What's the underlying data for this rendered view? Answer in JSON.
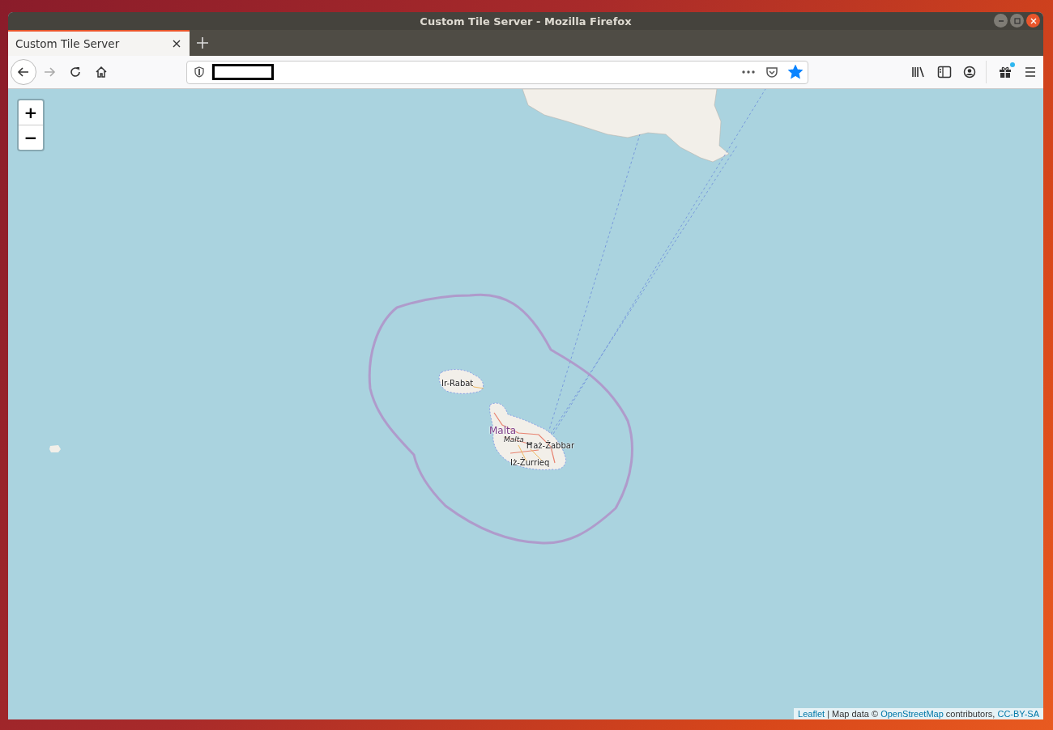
{
  "window": {
    "title": "Custom Tile Server - Mozilla Firefox"
  },
  "tabs": [
    {
      "label": "Custom Tile Server",
      "selected": true
    }
  ],
  "toolbar": {
    "forward_disabled": true,
    "bookmarked": true,
    "gift_notification": true
  },
  "map": {
    "zoom_controls": [
      "+",
      "−"
    ],
    "labels": [
      {
        "text": "Ir-Rabat",
        "kind": "town"
      },
      {
        "text": "Malta",
        "kind": "country"
      },
      {
        "text": "Malta",
        "kind": "island"
      },
      {
        "text": "Ħaż-Żabbar",
        "kind": "town"
      },
      {
        "text": "Iż-Żurrieq",
        "kind": "town"
      }
    ],
    "attribution": [
      {
        "text": "Leaflet",
        "kind": "link"
      },
      {
        "text": " | Map data © ",
        "kind": "text"
      },
      {
        "text": "OpenStreetMap",
        "kind": "link"
      },
      {
        "text": " contributors, ",
        "kind": "text"
      },
      {
        "text": "CC-BY-SA",
        "kind": "link"
      }
    ]
  }
}
